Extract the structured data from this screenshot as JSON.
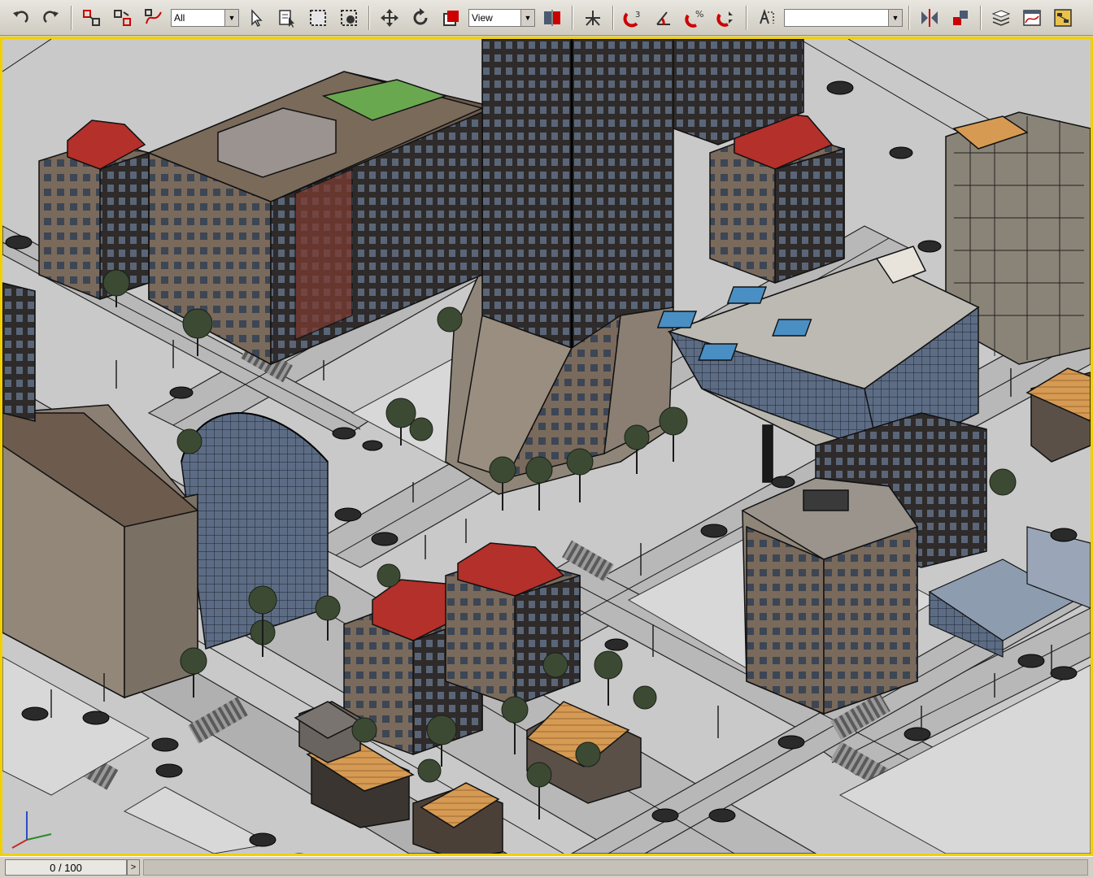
{
  "toolbar": {
    "selection_filter": "All",
    "reference_coord": "View",
    "named_selection": "",
    "buttons": [
      {
        "name": "undo-icon"
      },
      {
        "name": "redo-icon"
      },
      {
        "name": "select-and-link-icon"
      },
      {
        "name": "unlink-selection-icon"
      },
      {
        "name": "bind-to-space-warp-icon"
      },
      {
        "name": "select-object-icon"
      },
      {
        "name": "select-by-name-icon"
      },
      {
        "name": "rectangular-selection-icon"
      },
      {
        "name": "window-crossing-icon"
      },
      {
        "name": "select-and-move-icon"
      },
      {
        "name": "select-and-rotate-icon"
      },
      {
        "name": "select-and-scale-icon"
      },
      {
        "name": "pivot-center-icon"
      },
      {
        "name": "manipulate-icon"
      },
      {
        "name": "snaps-toggle-icon"
      },
      {
        "name": "angle-snap-icon"
      },
      {
        "name": "percent-snap-icon"
      },
      {
        "name": "spinner-snap-icon"
      },
      {
        "name": "edit-named-selection-icon"
      },
      {
        "name": "mirror-icon"
      },
      {
        "name": "align-icon"
      },
      {
        "name": "layer-manager-icon"
      },
      {
        "name": "curve-editor-icon"
      },
      {
        "name": "schematic-view-icon"
      }
    ]
  },
  "timeslider": {
    "frame_label": "0 / 100",
    "left_arrow": "<",
    "right_arrow": ">"
  },
  "colors": {
    "viewport_border": "#f2d000",
    "ground": "#c9c9c9",
    "road": "#b4b4b4",
    "roof_red": "#b4302a",
    "roof_orange": "#d79a4e",
    "building_brown": "#6d5b4d",
    "glass": "#4a5a70"
  }
}
